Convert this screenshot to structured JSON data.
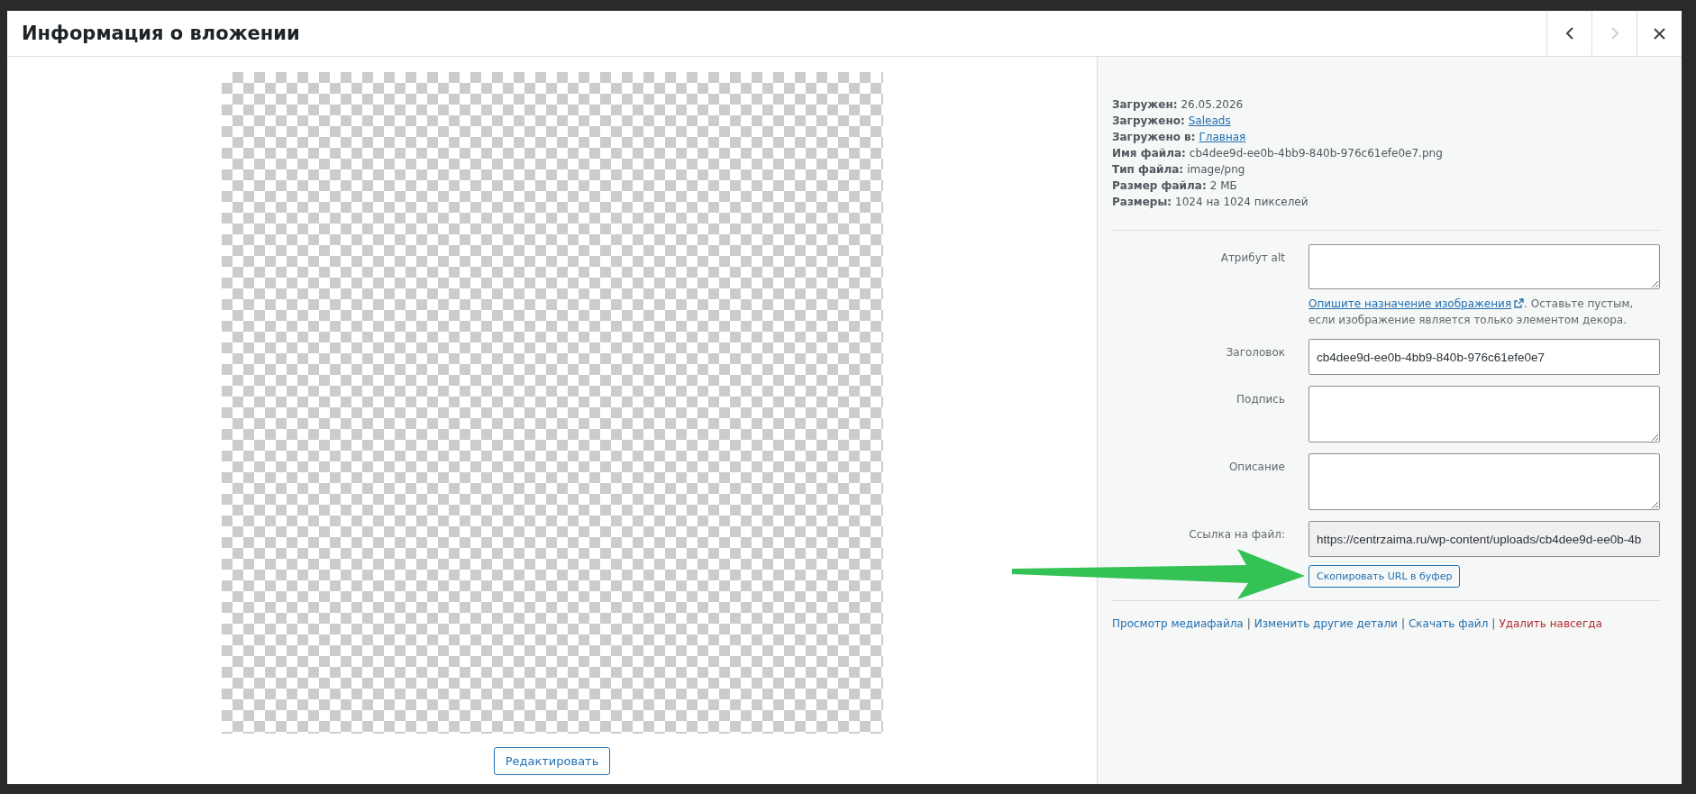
{
  "window": {
    "title": "Информация о вложении"
  },
  "nav": [
    {
      "kind": "prev",
      "disabled": false
    },
    {
      "kind": "next",
      "disabled": true
    },
    {
      "kind": "close",
      "disabled": false
    }
  ],
  "details": [
    {
      "label": "Загружен:",
      "value": "26.05.2026",
      "kind": "text"
    },
    {
      "label": "Загружено:",
      "value": "Saleads",
      "kind": "link"
    },
    {
      "label": "Загружено в:",
      "value": "Главная",
      "kind": "link"
    },
    {
      "label": "Имя файла:",
      "value": "cb4dee9d-ee0b-4bb9-840b-976c61efe0e7.png",
      "kind": "text"
    },
    {
      "label": "Тип файла:",
      "value": "image/png",
      "kind": "text"
    },
    {
      "label": "Размер файла:",
      "value": "2 МБ",
      "kind": "text"
    },
    {
      "label": "Размеры:",
      "value": "1024 на 1024 пикселей",
      "kind": "text"
    }
  ],
  "fields": [
    {
      "label": "Атрибут alt",
      "kind": "short_textarea",
      "help": {
        "link": "Опишите назначение изображения",
        "text": ". Оставьте пустым, если изображение является только элементом декора."
      }
    },
    {
      "label": "Заголовок",
      "kind": "input",
      "value": "cb4dee9d-ee0b-4bb9-840b-976c61efe0e7"
    },
    {
      "label": "Подпись",
      "kind": "textarea"
    },
    {
      "label": "Описание",
      "kind": "textarea"
    },
    {
      "label": "Ссылка на файл:",
      "kind": "readonly",
      "value": "https://centrzaima.ru/wp-content/uploads/cb4dee9d-ee0b-4b"
    }
  ],
  "copy_button": "Скопировать URL в буфер",
  "action_separator": "|",
  "actions": [
    {
      "label": "Просмотр медиафайла",
      "kind": "link"
    },
    {
      "label": "Изменить другие детали",
      "kind": "link"
    },
    {
      "label": "Скачать файл",
      "kind": "link"
    },
    {
      "label": "Удалить навсегда",
      "kind": "danger"
    }
  ],
  "edit_button": "Редактировать"
}
